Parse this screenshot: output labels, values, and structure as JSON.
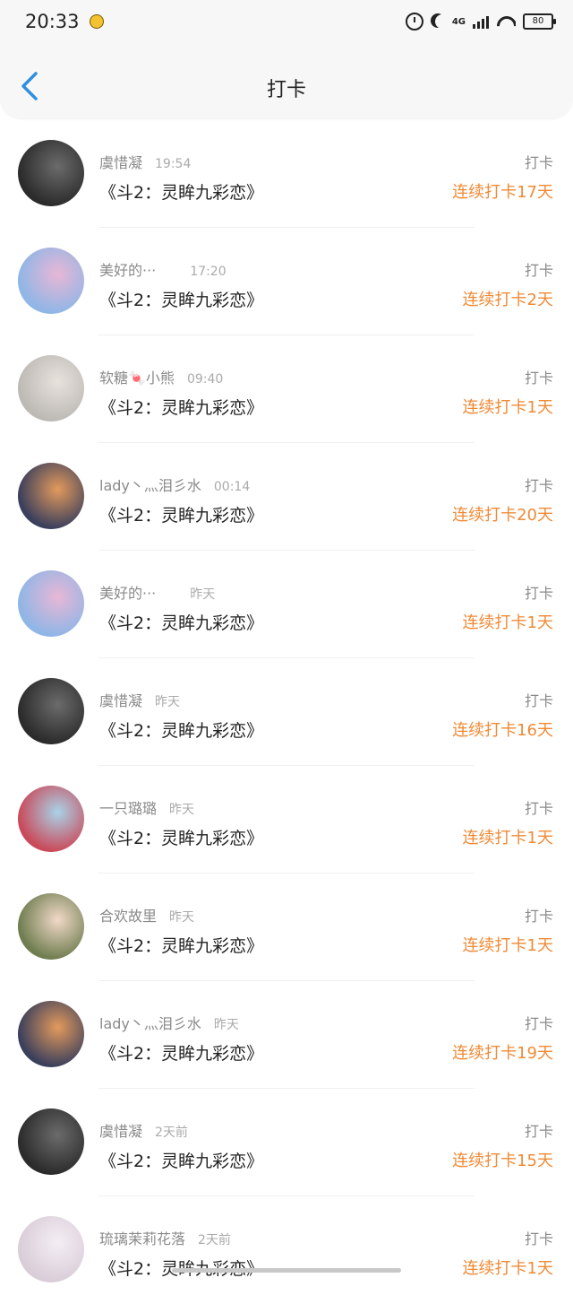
{
  "status_bar": {
    "time": "20:33",
    "network": "4G",
    "battery": "80"
  },
  "header": {
    "title": "打卡"
  },
  "items": [
    {
      "name": "虞惜凝",
      "time": "19:54",
      "book": "《斗2：灵眸九彩恋》",
      "label": "打卡",
      "streak": "连续打卡17天",
      "avatar_color": "#2b2b2b",
      "avatar_accent": "#6b6b6b"
    },
    {
      "name": "美好的···",
      "time": "17:20",
      "book": "《斗2：灵眸九彩恋》",
      "label": "打卡",
      "streak": "连续打卡2天",
      "avatar_color": "#8fb6e6",
      "avatar_accent": "#e8b7d6"
    },
    {
      "name": "软糖🍬小熊",
      "time": "09:40",
      "book": "《斗2：灵眸九彩恋》",
      "label": "打卡",
      "streak": "连续打卡1天",
      "avatar_color": "#bdb9b4",
      "avatar_accent": "#e7e2dc"
    },
    {
      "name": "lady丶灬泪彡水",
      "time": "00:14",
      "book": "《斗2：灵眸九彩恋》",
      "label": "打卡",
      "streak": "连续打卡20天",
      "avatar_color": "#3a3f5c",
      "avatar_accent": "#e39a5c"
    },
    {
      "name": "美好的···",
      "time": "昨天",
      "book": "《斗2：灵眸九彩恋》",
      "label": "打卡",
      "streak": "连续打卡1天",
      "avatar_color": "#8fb6e6",
      "avatar_accent": "#e8b7d6"
    },
    {
      "name": "虞惜凝",
      "time": "昨天",
      "book": "《斗2：灵眸九彩恋》",
      "label": "打卡",
      "streak": "连续打卡16天",
      "avatar_color": "#2b2b2b",
      "avatar_accent": "#6b6b6b"
    },
    {
      "name": "一只璐璐",
      "time": "昨天",
      "book": "《斗2：灵眸九彩恋》",
      "label": "打卡",
      "streak": "连续打卡1天",
      "avatar_color": "#c94a5a",
      "avatar_accent": "#a9d3e8"
    },
    {
      "name": "合欢故里",
      "time": "昨天",
      "book": "《斗2：灵眸九彩恋》",
      "label": "打卡",
      "streak": "连续打卡1天",
      "avatar_color": "#6f7d4f",
      "avatar_accent": "#f1d9c9"
    },
    {
      "name": "lady丶灬泪彡水",
      "time": "昨天",
      "book": "《斗2：灵眸九彩恋》",
      "label": "打卡",
      "streak": "连续打卡19天",
      "avatar_color": "#3a3f5c",
      "avatar_accent": "#e39a5c"
    },
    {
      "name": "虞惜凝",
      "time": "2天前",
      "book": "《斗2：灵眸九彩恋》",
      "label": "打卡",
      "streak": "连续打卡15天",
      "avatar_color": "#2b2b2b",
      "avatar_accent": "#6b6b6b"
    },
    {
      "name": "琉璃茉莉花落",
      "time": "2天前",
      "book": "《斗2：灵眸九彩恋》",
      "label": "打卡",
      "streak": "连续打卡1天",
      "avatar_color": "#d9cdd8",
      "avatar_accent": "#f4eef4"
    }
  ],
  "colors": {
    "accent": "#f08a35",
    "back_arrow": "#2f8fe0"
  }
}
